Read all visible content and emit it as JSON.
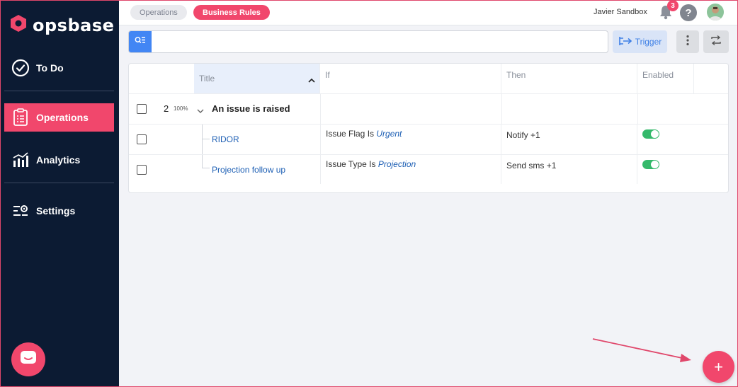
{
  "app": {
    "logo_text": "opsbase"
  },
  "sidebar": {
    "items": [
      {
        "label": "To Do",
        "icon": "check-circle-icon"
      },
      {
        "label": "Operations",
        "icon": "clipboard-icon",
        "active": true
      },
      {
        "label": "Analytics",
        "icon": "bar-chart-icon"
      },
      {
        "label": "Settings",
        "icon": "settings-sliders-icon"
      }
    ]
  },
  "topbar": {
    "tabs": [
      {
        "label": "Operations"
      },
      {
        "label": "Business Rules",
        "active": true
      }
    ],
    "user_name": "Javier Sandbox",
    "notification_count": "3",
    "help_label": "?"
  },
  "toolbar": {
    "search": {
      "value": "",
      "placeholder": ""
    },
    "trigger_label": "Trigger"
  },
  "table": {
    "columns": [
      "Title",
      "If",
      "Then",
      "Enabled"
    ],
    "group": {
      "count": "2",
      "percent": "100%",
      "title": "An issue is raised"
    },
    "rows": [
      {
        "title": "RIDOR",
        "if_prefix": "Issue Flag Is ",
        "if_value": "Urgent",
        "then": "Notify +1",
        "enabled": true
      },
      {
        "title": "Projection follow up",
        "if_prefix": "Issue Type Is ",
        "if_value": "Projection",
        "then": "Send sms +1",
        "enabled": true
      }
    ]
  },
  "fab_label": "+",
  "colors": {
    "brand": "#f1476c",
    "sidebar": "#0c1b33",
    "accent_blue": "#4286f4",
    "toggle_on": "#35b96b"
  }
}
